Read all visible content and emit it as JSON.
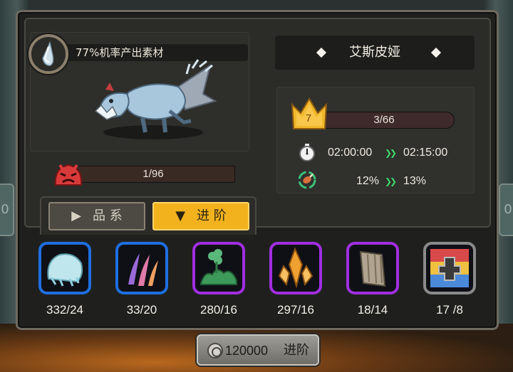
{
  "monster": {
    "name": "艾斯皮娅",
    "drop_rate_text": "77%机率产出素材"
  },
  "hp": {
    "text": "1/96",
    "current": 1,
    "max": 96
  },
  "level": {
    "value": "7",
    "progress_text": "3/66",
    "current": 3,
    "max": 66
  },
  "stats": {
    "time_current": "02:00:00",
    "time_next": "02:15:00",
    "rate_current": "12%",
    "rate_next": "13%"
  },
  "tabs": {
    "quality_label": "品 系",
    "advance_label": "进 阶",
    "active": "advance"
  },
  "materials": [
    {
      "icon": "ice-rock-icon",
      "count": "332/24",
      "border": "#1f6ee0"
    },
    {
      "icon": "claw-icon",
      "count": "33/20",
      "border": "#1f6ee0"
    },
    {
      "icon": "clover-bush-icon",
      "count": "280/16",
      "border": "#a02ee0"
    },
    {
      "icon": "amber-crystal-icon",
      "count": "297/16",
      "border": "#a02ee0"
    },
    {
      "icon": "wood-plank-icon",
      "count": "18/14",
      "border": "#a02ee0"
    },
    {
      "icon": "banner-emblem-icon",
      "count": "17 /8",
      "border": "#8a8a8a"
    }
  ],
  "advance_button": {
    "cost": "120000",
    "label": "进阶"
  },
  "side_tabs": {
    "left": "0",
    "right": "0"
  },
  "colors": {
    "accent_gold": "#f2b21e",
    "blue_rarity": "#1f6ee0",
    "purple_rarity": "#a02ee0",
    "arrow_green": "#3cd66a"
  }
}
